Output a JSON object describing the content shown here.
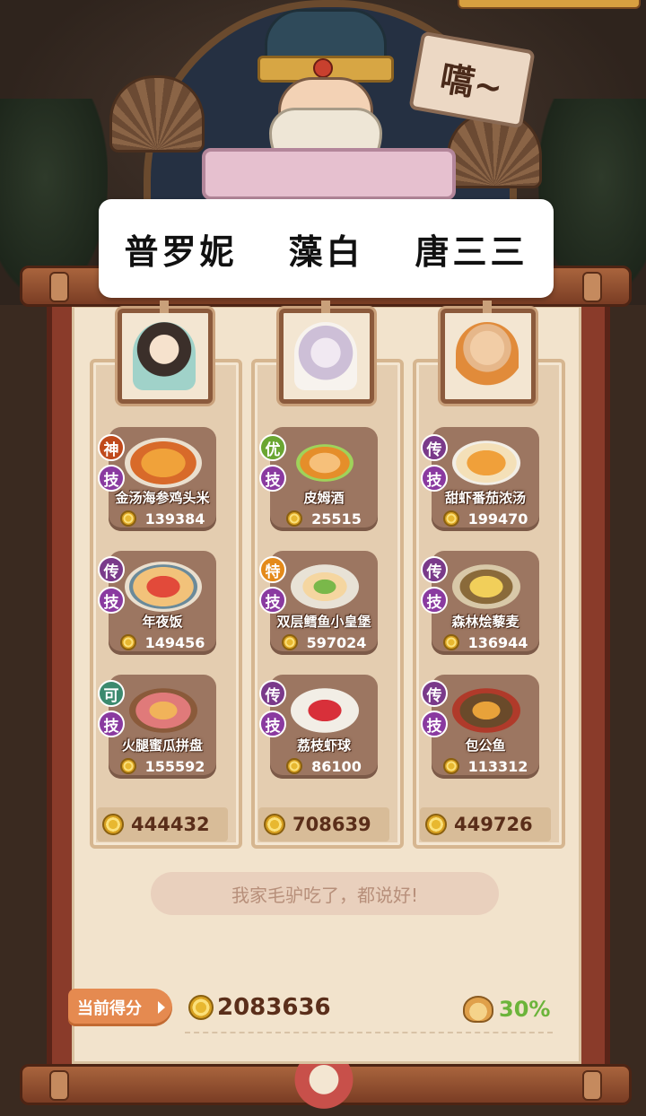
{
  "sign_text": "嚆~",
  "players": [
    "普罗妮",
    "藻白",
    "唐三三"
  ],
  "columns": [
    {
      "avatar": "chef-woman-avatar",
      "dishes": [
        {
          "badge": "神",
          "skill": "技",
          "name": "金汤海参鸡头米",
          "score": "139384"
        },
        {
          "badge": "传",
          "skill": "技",
          "name": "年夜饭",
          "score": "149456"
        },
        {
          "badge": "可",
          "skill": "技",
          "name": "火腿蜜瓜拼盘",
          "score": "155592"
        }
      ],
      "total": "444432"
    },
    {
      "avatar": "chef-ghost-avatar",
      "dishes": [
        {
          "badge": "优",
          "skill": "技",
          "name": "皮姆酒",
          "score": "25515"
        },
        {
          "badge": "特",
          "skill": "技",
          "name": "双层鳕鱼小皇堡",
          "score": "597024"
        },
        {
          "badge": "传",
          "skill": "技",
          "name": "荔枝虾球",
          "score": "86100"
        }
      ],
      "total": "708639"
    },
    {
      "avatar": "chef-monk-avatar",
      "dishes": [
        {
          "badge": "传",
          "skill": "技",
          "name": "甜虾番茄浓汤",
          "score": "199470"
        },
        {
          "badge": "传",
          "skill": "技",
          "name": "森林烩藜麦",
          "score": "136944"
        },
        {
          "badge": "传",
          "skill": "技",
          "name": "包公鱼",
          "score": "113312"
        }
      ],
      "total": "449726"
    }
  ],
  "quote": "我家毛驴吃了，都说好!",
  "score_label": "当前得分",
  "total_score": "2083636",
  "bonus": "30%",
  "colors": {
    "paper": "#f2e3cc",
    "scroll": "#8a3b2a",
    "dish_card": "#9c7661",
    "bonus_green": "#6cb43a",
    "score_orange": "#e58a50"
  }
}
